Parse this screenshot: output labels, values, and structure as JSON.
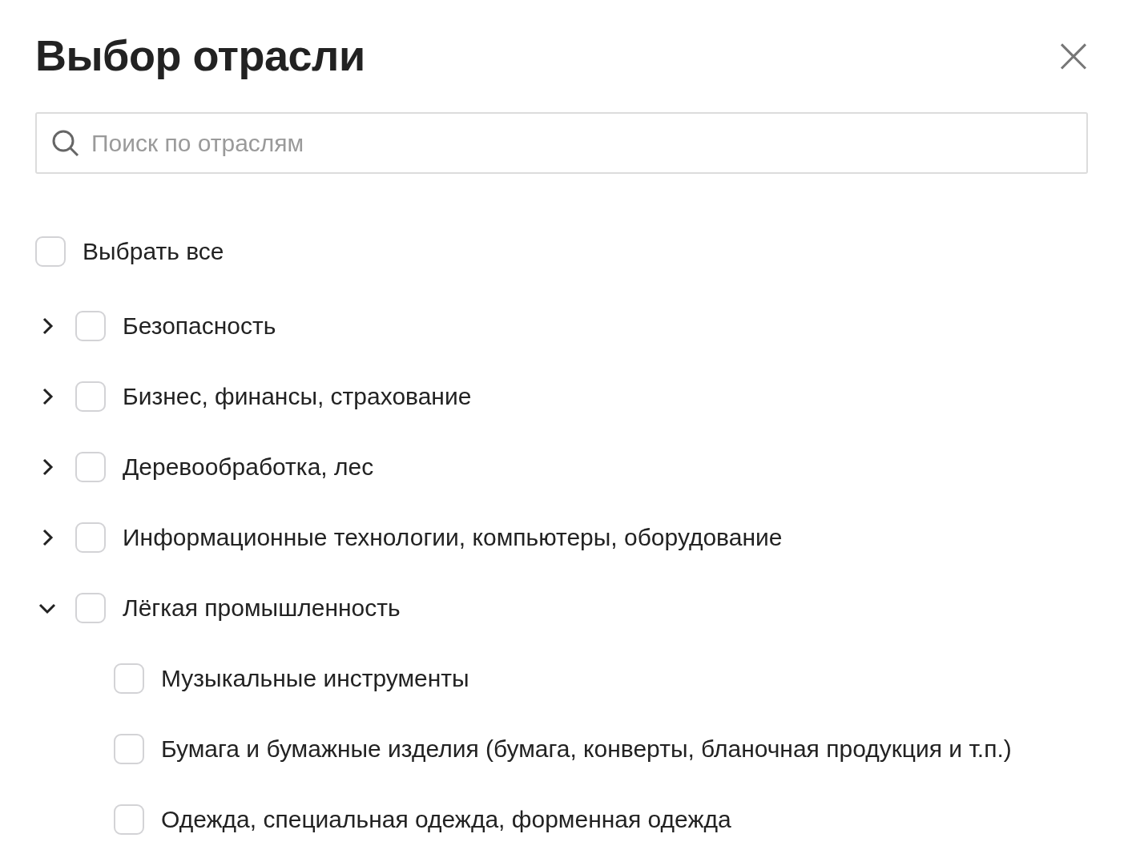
{
  "title": "Выбор отрасли",
  "close": "×",
  "search": {
    "placeholder": "Поиск по отраслям"
  },
  "select_all": {
    "label": "Выбрать все",
    "checked": false
  },
  "industries": [
    {
      "label": "Безопасность",
      "checked": false,
      "expanded": false
    },
    {
      "label": "Бизнес, финансы, страхование",
      "checked": false,
      "expanded": false
    },
    {
      "label": "Деревообработка, лес",
      "checked": false,
      "expanded": false
    },
    {
      "label": "Информационные технологии, компьютеры, оборудование",
      "checked": false,
      "expanded": false
    },
    {
      "label": "Лёгкая промышленность",
      "checked": false,
      "expanded": true,
      "children": [
        {
          "label": "Музыкальные инструменты",
          "checked": false
        },
        {
          "label": "Бумага и бумажные изделия (бумага, конверты, бланочная продукция и т.п.)",
          "checked": false
        },
        {
          "label": "Одежда, специальная одежда, форменная одежда",
          "checked": false
        }
      ]
    }
  ]
}
